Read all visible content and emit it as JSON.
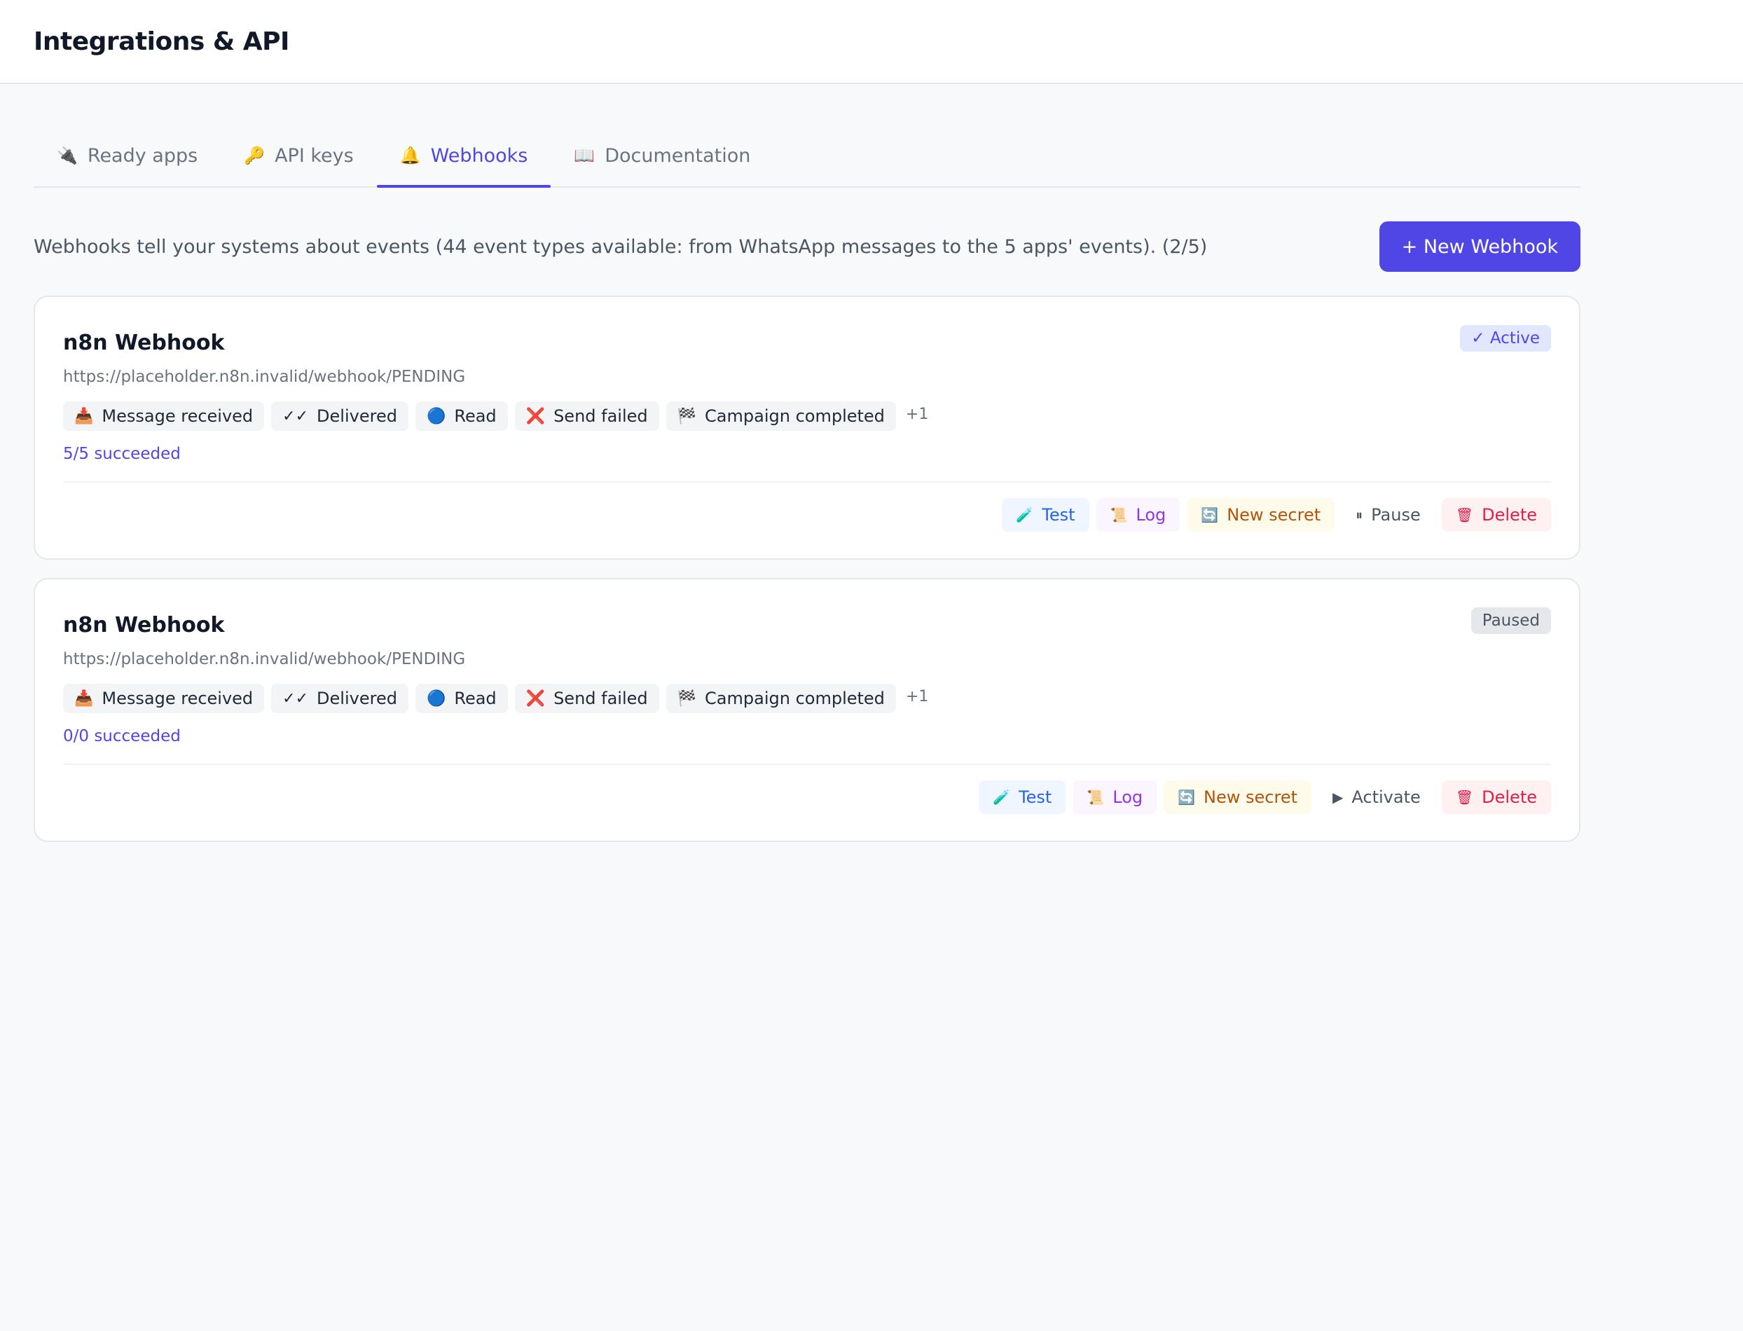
{
  "header": {
    "title": "Integrations & API"
  },
  "tabs": [
    {
      "icon": "🔌",
      "label": "Ready apps"
    },
    {
      "icon": "🔑",
      "label": "API keys"
    },
    {
      "icon": "🔔",
      "label": "Webhooks"
    },
    {
      "icon": "📖",
      "label": "Documentation"
    }
  ],
  "intro": {
    "text": "Webhooks tell your systems about events (44 event types available: from WhatsApp messages to the 5 apps' events). (2/5)",
    "new_button": "+ New Webhook"
  },
  "webhooks": [
    {
      "title": "n8n Webhook",
      "status": "✓ Active",
      "url": "https://placeholder.n8n.invalid/webhook/PENDING",
      "events": [
        {
          "icon": "📥",
          "label": "Message received"
        },
        {
          "icon": "✓✓",
          "label": "Delivered"
        },
        {
          "icon": "🔵",
          "label": "Read"
        },
        {
          "icon": "❌",
          "label": "Send failed"
        },
        {
          "icon": "🏁",
          "label": "Campaign completed"
        }
      ],
      "more": "+1",
      "stats": "5/5 succeeded",
      "actions": {
        "test": "Test",
        "test_icon": "🧪",
        "log": "Log",
        "log_icon": "📜",
        "secret": "New secret",
        "secret_icon": "🔄",
        "toggle": "Pause",
        "toggle_icon": "⏸",
        "delete": "Delete",
        "delete_icon": "🗑"
      }
    },
    {
      "title": "n8n Webhook",
      "status": "Paused",
      "url": "https://placeholder.n8n.invalid/webhook/PENDING",
      "events": [
        {
          "icon": "📥",
          "label": "Message received"
        },
        {
          "icon": "✓✓",
          "label": "Delivered"
        },
        {
          "icon": "🔵",
          "label": "Read"
        },
        {
          "icon": "❌",
          "label": "Send failed"
        },
        {
          "icon": "🏁",
          "label": "Campaign completed"
        }
      ],
      "more": "+1",
      "stats": "0/0 succeeded",
      "actions": {
        "test": "Test",
        "test_icon": "🧪",
        "log": "Log",
        "log_icon": "📜",
        "secret": "New secret",
        "secret_icon": "🔄",
        "toggle": "Activate",
        "toggle_icon": "▶",
        "delete": "Delete",
        "delete_icon": "🗑"
      }
    }
  ],
  "colors": {
    "accent": "#4f46e5",
    "background": "#f8f9fb",
    "active_badge_bg": "#e0e7ff",
    "delete": "#e11d48"
  }
}
